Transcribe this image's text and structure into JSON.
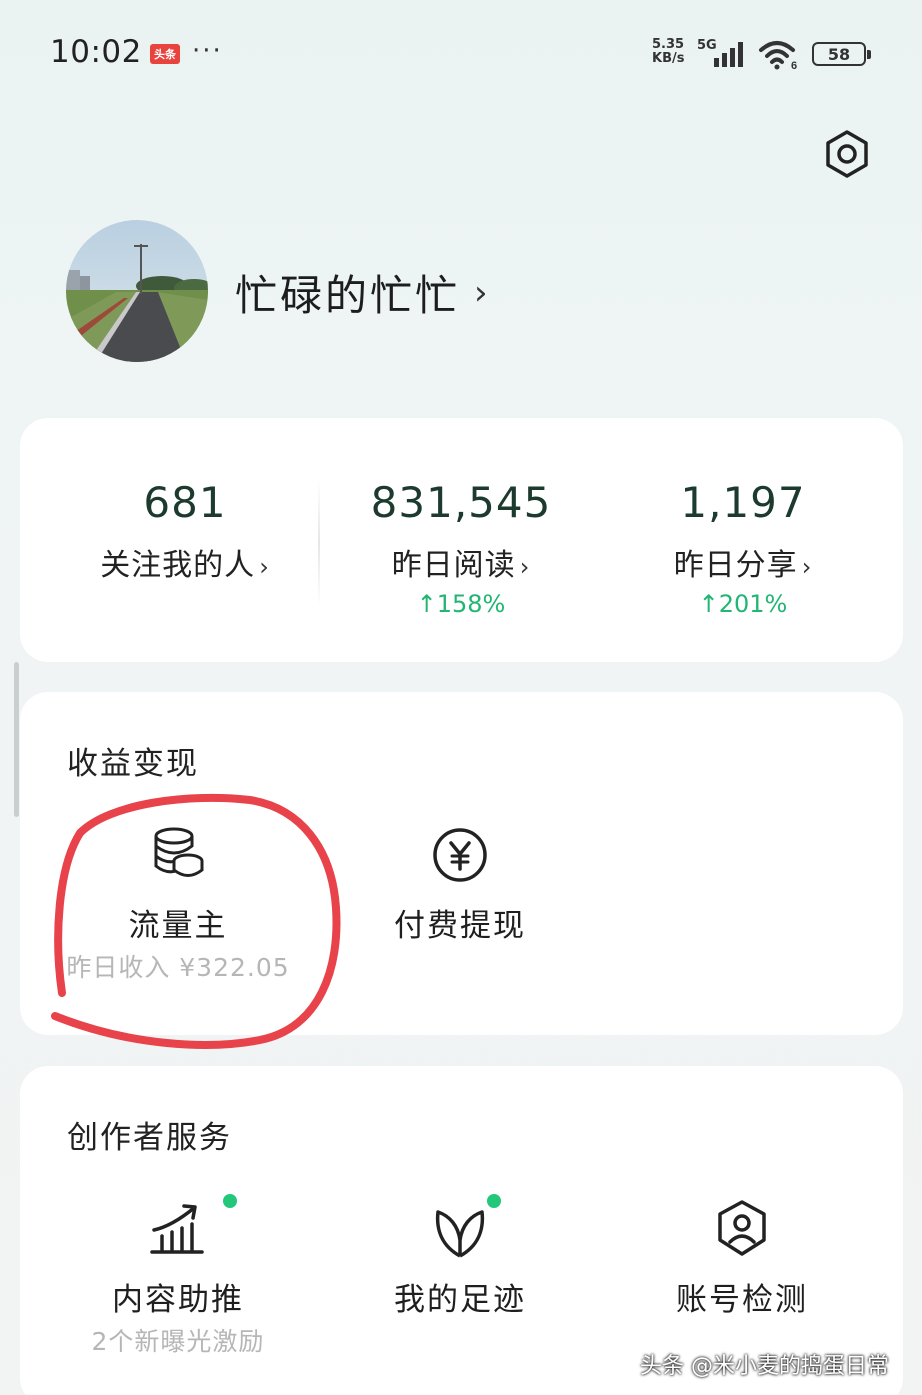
{
  "status_bar": {
    "time": "10:02",
    "app_badge": "头条",
    "more": "···",
    "net_speed_value": "5.35",
    "net_speed_unit": "KB/s",
    "network": "5G",
    "battery": "58"
  },
  "profile": {
    "name": "忙碌的忙忙",
    "chevron": "›"
  },
  "stats": [
    {
      "value": "681",
      "label": "关注我的人",
      "change": ""
    },
    {
      "value": "831,545",
      "label": "昨日阅读",
      "change": "↑158%"
    },
    {
      "value": "1,197",
      "label": "昨日分享",
      "change": "↑201%"
    }
  ],
  "earnings": {
    "title": "收益变现",
    "items": [
      {
        "icon": "coins-icon",
        "label": "流量主",
        "sub": "昨日收入 ¥322.05"
      },
      {
        "icon": "yen-circle-icon",
        "label": "付费提现",
        "sub": ""
      }
    ]
  },
  "creator_services": {
    "title": "创作者服务",
    "items": [
      {
        "icon": "growth-chart-icon",
        "label": "内容助推",
        "sub": "2个新曝光激励",
        "new_dot": true
      },
      {
        "icon": "sprout-icon",
        "label": "我的足迹",
        "sub": "",
        "new_dot": true
      },
      {
        "icon": "shield-user-icon",
        "label": "账号检测",
        "sub": "",
        "new_dot": false
      }
    ]
  },
  "watermark": "头条 @米小麦的捣蛋日常",
  "colors": {
    "accent_green": "#22b573",
    "annotation_red": "#e8424a",
    "number_dark": "#1c3a2e"
  }
}
